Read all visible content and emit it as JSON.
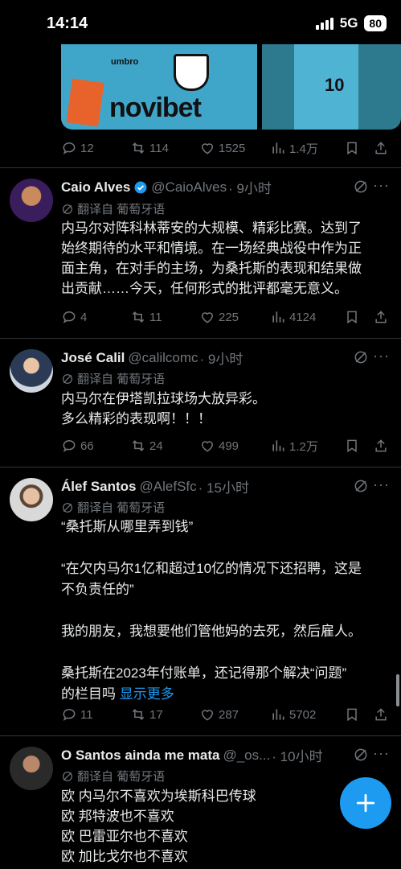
{
  "status": {
    "time": "14:14",
    "network": "5G",
    "battery": "80"
  },
  "media": {
    "brand": "umbro",
    "sponsor": "novibet",
    "number": "10"
  },
  "top_actions": {
    "reply": "12",
    "repost": "114",
    "like": "1525",
    "views": "1.4万"
  },
  "translate_label": "翻译自 葡萄牙语",
  "tweets": [
    {
      "name": "Caio Alves",
      "handle": "@CaioAlves",
      "time": "· 9小时",
      "verified": true,
      "translate": "翻译自 葡萄牙语",
      "lines": [
        "内马尔对阵科林蒂安的大规模、精彩比赛。达到了",
        "始终期待的水平和情境。在一场经典战役中作为正",
        "面主角，在对手的主场，为桑托斯的表现和结果做",
        "出贡献……今天，任何形式的批评都毫无意义。"
      ],
      "actions": {
        "reply": "4",
        "repost": "11",
        "like": "225",
        "views": "4124"
      }
    },
    {
      "name": "José Calil",
      "handle": "@calilcomc",
      "time": "· 9小时",
      "translate": "翻译自 葡萄牙语",
      "lines": [
        "内马尔在伊塔凯拉球场大放异彩。",
        "多么精彩的表现啊！！！"
      ],
      "actions": {
        "reply": "66",
        "repost": "24",
        "like": "499",
        "views": "1.2万"
      }
    },
    {
      "name": "Álef Santos",
      "handle": "@AlefSfc",
      "time": "· 15小时",
      "translate": "翻译自 葡萄牙语",
      "lines": [
        "“桑托斯从哪里弄到钱”",
        "",
        "“在欠内马尔1亿和超过10亿的情况下还招聘，这是",
        "不负责任的”",
        "",
        "我的朋友，我想要他们管他妈的去死，然后雇人。",
        "",
        "桑托斯在2023年付账单，还记得那个解决“问题”",
        "的栏目吗"
      ],
      "show_more": "显示更多",
      "actions": {
        "reply": "11",
        "repost": "17",
        "like": "287",
        "views": "5702"
      }
    },
    {
      "name": "O Santos ainda me mata",
      "handle": "@_os...",
      "time": "· 10小时",
      "translate": "翻译自 葡萄牙语",
      "lines": [
        "欧 内马尔不喜欢为埃斯科巴传球",
        "欧 邦特波也不喜欢",
        "欧 巴雷亚尔也不喜欢",
        "欧 加比戈尔也不喜欢"
      ]
    }
  ],
  "colors": {
    "accent": "#1d9bf0",
    "muted": "#71767b",
    "divider": "#2f3336"
  }
}
